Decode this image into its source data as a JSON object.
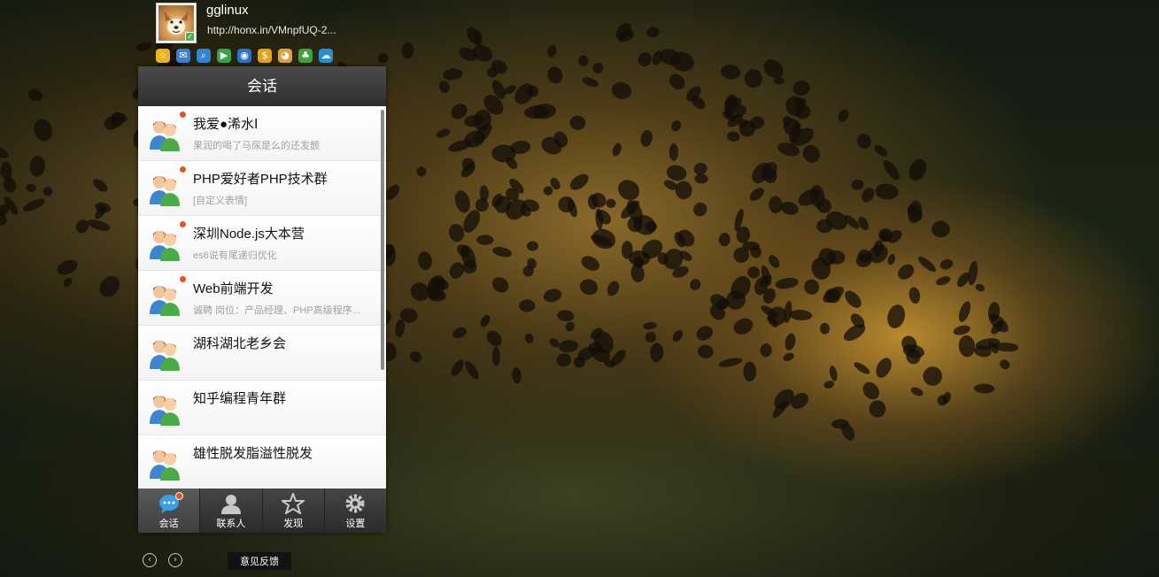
{
  "profile": {
    "name": "gglinux",
    "url": "http://honx.in/VMnpfUQ-2..."
  },
  "app_icons": [
    {
      "name": "favorites-icon",
      "color": "#e8b41c",
      "glyph": "☆"
    },
    {
      "name": "mail-icon",
      "color": "#3d7ecf",
      "glyph": "✉"
    },
    {
      "name": "search-icon",
      "color": "#2e86d6",
      "glyph": "⌕"
    },
    {
      "name": "play-icon",
      "color": "#3aa04a",
      "glyph": "▶"
    },
    {
      "name": "browser-icon",
      "color": "#2a74c9",
      "glyph": "◉"
    },
    {
      "name": "money-bag-icon",
      "color": "#e2a320",
      "glyph": "$"
    },
    {
      "name": "pet-icon",
      "color": "#e0a040",
      "glyph": "◕"
    },
    {
      "name": "clover-icon",
      "color": "#3aa63a",
      "glyph": "♣"
    },
    {
      "name": "cloud-icon",
      "color": "#2a8ed0",
      "glyph": "☁"
    }
  ],
  "panel": {
    "title": "会话"
  },
  "conversations": [
    {
      "name": "我爱●浠水Ⅰ",
      "message": "果润的喝了马尿是么的还发颤",
      "unread": true
    },
    {
      "name": "PHP爱好者PHP技术群",
      "message": "[自定义表情]",
      "unread": true
    },
    {
      "name": "深圳Node.js大本营",
      "message": "es6说有尾递归优化",
      "unread": true
    },
    {
      "name": "Web前端开发",
      "message": "诚聘 岗位：产品经理、PHP高级程序...",
      "unread": true
    },
    {
      "name": "湖科湖北老乡会",
      "message": "",
      "unread": false
    },
    {
      "name": "知乎编程青年群",
      "message": "",
      "unread": false
    },
    {
      "name": "雄性脱发脂溢性脱发",
      "message": "",
      "unread": false
    }
  ],
  "tabs": [
    {
      "label": "会话",
      "icon": "chat-bubble-icon",
      "active": true,
      "badge": true
    },
    {
      "label": "联系人",
      "icon": "contact-person-icon",
      "active": false,
      "badge": false
    },
    {
      "label": "发现",
      "icon": "discover-star-icon",
      "active": false,
      "badge": false
    },
    {
      "label": "设置",
      "icon": "settings-gear-icon",
      "active": false,
      "badge": false
    }
  ],
  "footer": {
    "feedback_label": "意见反馈",
    "prev_glyph": "‹",
    "next_glyph": "›"
  }
}
